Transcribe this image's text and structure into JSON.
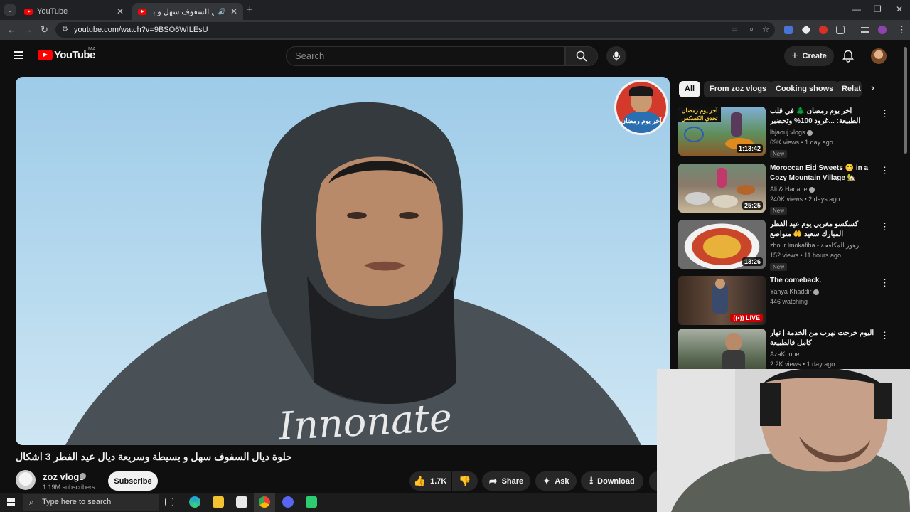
{
  "browser": {
    "tabs": [
      {
        "title": "YouTube",
        "active": false
      },
      {
        "title": "حلوة ديال السفوف سهل و بـ...",
        "active": true
      }
    ],
    "new_tab": "+",
    "url": "youtube.com/watch?v=9BSO6WILEsU"
  },
  "youtube": {
    "logo_text": "YouTube",
    "country_code": "MA",
    "search_placeholder": "Search",
    "create_label": "Create"
  },
  "video": {
    "title": "حلوة ديال السفوف سهل و بسيطة وسريعة ديال عيد الفطر 3 اشكال",
    "channel": "zoz vlogs",
    "subscribers": "1.19M subscribers",
    "subscribe_label": "Subscribe",
    "likes": "1.7K",
    "share_label": "Share",
    "ask_label": "Ask",
    "download_label": "Download",
    "watermark_text": "آخر يوم رمضان"
  },
  "sidebar": {
    "chips": [
      "All",
      "From zoz vlogs",
      "Cooking shows",
      "Relat"
    ],
    "recommendations": [
      {
        "title": "آخر يوم رمضان 🌲 في قلب الطبيعة: ...غرود 100% وتحضير كسكس مغربي في",
        "channel": "lhjaouj vlogs",
        "verified": true,
        "meta": "69K views • 1 day ago",
        "badge": "New",
        "duration": "1:13:42",
        "thumb_label": "آخر يوم رمضان تحدي الكسكس"
      },
      {
        "title": "Moroccan Eid Sweets 😊 in a Cozy Mountain Village 🏡",
        "channel": "Ali & Hanane",
        "verified": true,
        "meta": "240K views • 2 days ago",
        "badge": "New",
        "duration": "25:25"
      },
      {
        "title": "كسكسو مغربي يوم عيد الفطر المبارك سعيد 🤲 متواضع",
        "channel": "zhour lmokafiha - زهور المكافحة",
        "verified": false,
        "meta": "152 views • 11 hours ago",
        "badge": "New",
        "duration": "13:26"
      },
      {
        "title": "The comeback.",
        "channel": "Yahya Khaddir",
        "verified": true,
        "meta": "446 watching",
        "badge": "",
        "live_label": "LIVE"
      },
      {
        "title": "اليوم خرجت نهرب من الخدمة | نهار كامل فالطبيعة",
        "channel": "AzaKoune",
        "verified": false,
        "meta": "2.2K views • 1 day ago",
        "badge": ""
      }
    ]
  },
  "taskbar": {
    "search_placeholder": "Type here to search"
  }
}
